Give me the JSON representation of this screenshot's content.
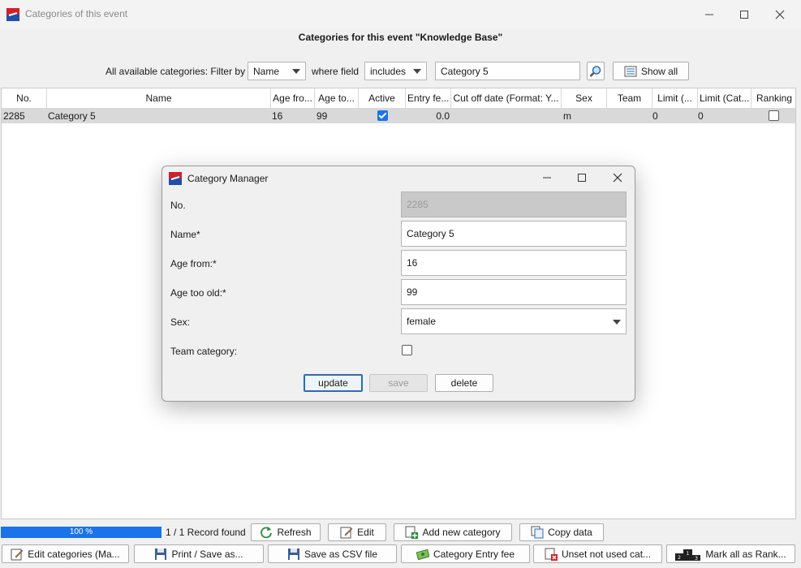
{
  "window": {
    "title": "Categories of this event"
  },
  "heading": "Categories for this event \"Knowledge Base\"",
  "filter": {
    "label": "All available categories: Filter by",
    "field_value": "Name",
    "where_label": "where field",
    "operator_value": "includes",
    "search_value": "Category 5",
    "show_all_label": "Show all"
  },
  "table": {
    "columns": [
      "No.",
      "Name",
      "Age fro...",
      "Age to...",
      "Active",
      "Entry fe...",
      "Cut off date (Format: Y...",
      "Sex",
      "Team",
      "Limit (...",
      "Limit (Cat...",
      "Ranking"
    ],
    "row": {
      "no": "2285",
      "name": "Category 5",
      "age_from": "16",
      "age_to": "99",
      "active": true,
      "entry_fee": "0.0",
      "cutoff": "",
      "sex": "m",
      "team": "",
      "limit1": "0",
      "limit2": "0",
      "ranking": false
    }
  },
  "dialog": {
    "title": "Category Manager",
    "labels": {
      "no": "No.",
      "name": "Name*",
      "age_from": "Age from:*",
      "age_to": "Age too old:*",
      "sex": "Sex:",
      "team": "Team category:"
    },
    "values": {
      "no": "2285",
      "name": "Category 5",
      "age_from": "16",
      "age_to": "99",
      "sex": "female"
    },
    "buttons": {
      "update": "update",
      "save": "save",
      "delete": "delete"
    }
  },
  "status": {
    "progress_text": "100 %",
    "progress_percent": 100,
    "record_text": "1 / 1 Record found"
  },
  "actions_row1": {
    "refresh": "Refresh",
    "edit": "Edit",
    "add": "Add new category",
    "copy": "Copy data"
  },
  "actions_row2": {
    "edit_cats": "Edit categories (Ma...",
    "print": "Print / Save as...",
    "csv": "Save as CSV file",
    "entry_fee": "Category Entry fee",
    "unset": "Unset not used cat...",
    "mark": "Mark all as Rank..."
  },
  "colors": {
    "accent": "#1a73e8",
    "selected_row": "#d9d9d9"
  }
}
